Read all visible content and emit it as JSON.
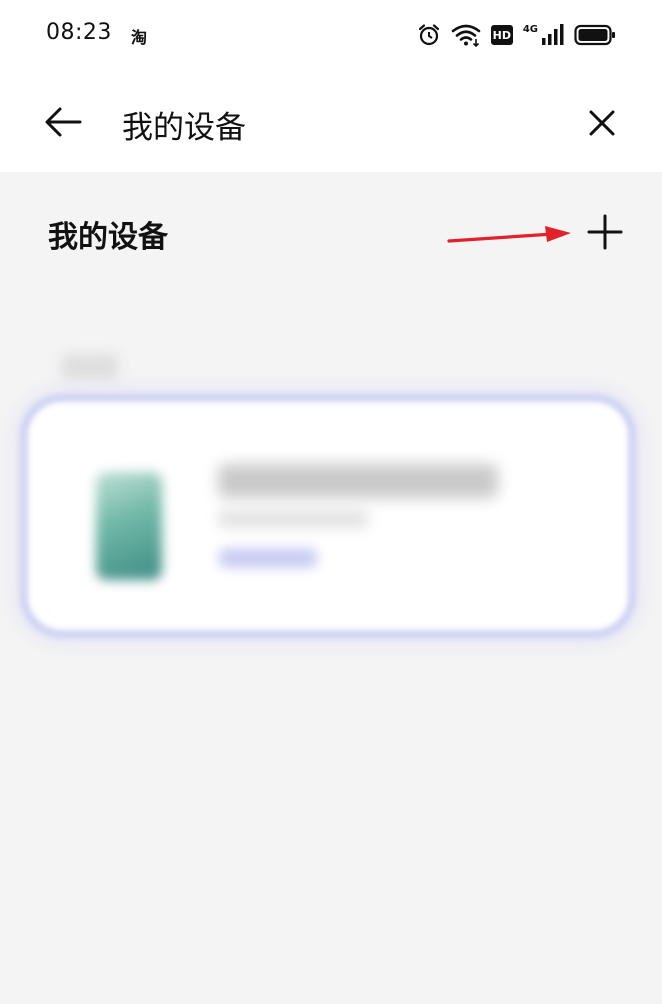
{
  "status_bar": {
    "time": "08:23",
    "app_indicator": "淘",
    "hd_label": "HD",
    "network_label": "4G"
  },
  "header": {
    "title": "我的设备",
    "back_icon": "arrow-left-icon",
    "close_icon": "close-icon"
  },
  "section": {
    "title": "我的设备",
    "add_icon": "plus-icon"
  },
  "colors": {
    "annotation_arrow": "#e3212b",
    "card_border": "#cfd3f3",
    "background": "#f4f4f4"
  }
}
